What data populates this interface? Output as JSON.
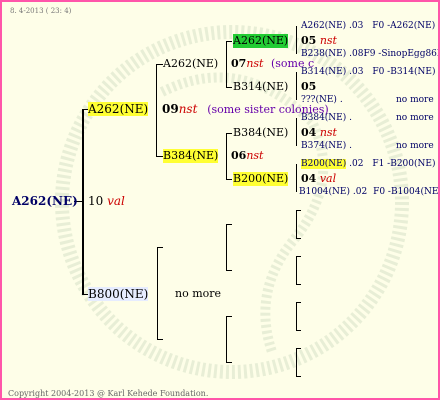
{
  "header": {
    "date_stamp": "8.  4-2013 ( 23:  4)"
  },
  "footer": {
    "copyright": "Copyright 2004-2013 @ Karl Kehede Foundation."
  },
  "root": {
    "name": "A262(NE)",
    "year": "10",
    "tag": "val"
  },
  "gen1": {
    "top": {
      "name": "A262(NE)",
      "year": "09",
      "tag": "nst",
      "note": "(some sister colonies)"
    },
    "bottom": {
      "name": "B800(NE)",
      "note": "no more"
    }
  },
  "gen2": {
    "a": {
      "name": "A262(NE)",
      "year": "07",
      "tag": "nst",
      "note": "(some c"
    },
    "b": {
      "name": "B384(NE)",
      "year": "06",
      "tag": "nst"
    }
  },
  "gen3": {
    "a1": {
      "name": "A262(NE)",
      "year": "05",
      "tag": "nst"
    },
    "a2": {
      "name": "B314(NE)",
      "year": "05"
    },
    "b1": {
      "name": "B384(NE)",
      "year": "04",
      "tag": "nst"
    },
    "b2": {
      "name": "B200(NE)",
      "year": "04",
      "tag": "val"
    }
  },
  "gen4": [
    {
      "name": "A262(NE)",
      "num": ".03",
      "ref": "F0 -A262(NE)"
    },
    {
      "name": "B238(NE)",
      "num": ".08",
      "ref": "F9 -SinopEgg86R"
    },
    {
      "name": "B314(NE)",
      "num": ".03",
      "ref": "F0 -B314(NE)"
    },
    {
      "name": "???(NE)",
      "num": ".",
      "ref": "no more"
    },
    {
      "name": "B384(NE)",
      "num": ".",
      "ref": "no more"
    },
    {
      "name": "B374(NE)",
      "num": ".",
      "ref": "no more"
    },
    {
      "name": "B200(NE)",
      "num": ".02",
      "ref": "F1 -B200(NE)"
    },
    {
      "name": "B1004(NE)",
      "num": ".02",
      "ref": "F0 -B1004(NE)"
    }
  ],
  "colors": {
    "border": "#ff55aa",
    "background": "#fefee8",
    "highlight_yellow": "#ffff33",
    "highlight_green": "#22cc33"
  }
}
